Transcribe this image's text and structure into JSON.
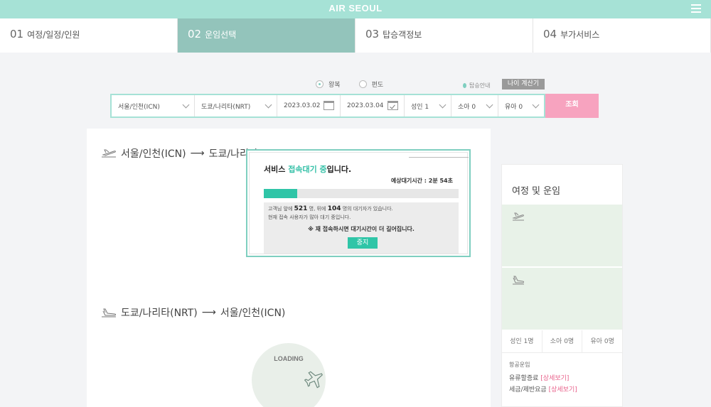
{
  "header": {
    "logo": "AIR SEOUL",
    "menu_icon": "hamburger-icon"
  },
  "steps": [
    {
      "num": "01",
      "label": "여정/일정/인원",
      "active": false
    },
    {
      "num": "02",
      "label": "운임선택",
      "active": true
    },
    {
      "num": "03",
      "label": "탑승객정보",
      "active": false
    },
    {
      "num": "04",
      "label": "부가서비스",
      "active": false
    }
  ],
  "trip_type": {
    "round_trip": "왕복",
    "one_way": "편도",
    "selected": "round_trip"
  },
  "notice": "탑승안내",
  "age_calc_button": "나이 계산기",
  "search": {
    "origin": "서울/인천(ICN)",
    "destination": "도쿄/나리타(NRT)",
    "depart_date": "2023.03.02",
    "return_date": "2023.03.04",
    "adult": "성인 1",
    "child": "소아 0",
    "infant": "유아 0",
    "submit": "조회"
  },
  "routes": {
    "outbound": {
      "from": "서울/인천(ICN)",
      "arrow": "⟶",
      "to": "도쿄/나리타(NRT)"
    },
    "inbound": {
      "from": "도쿄/나리타(NRT)",
      "arrow": "⟶",
      "to": "서울/인천(ICN)"
    }
  },
  "loading": {
    "text": "LOADING"
  },
  "summary": {
    "title": "여정 및 운임",
    "pax": [
      "성인 1명",
      "소아 0명",
      "유아 0명"
    ],
    "fare_label": "항공운임",
    "fuel": "유류할증료",
    "tax": "세금/제반요금",
    "detail_link": "[상세보기]"
  },
  "queue_modal": {
    "title_prefix": "서비스 ",
    "title_highlight": "접속대기 중",
    "title_suffix": "입니다.",
    "wait_label": "예상대기시간 : ",
    "wait_time": "2분 54초",
    "progress": 0.17,
    "line1_prefix": "고객님 앞에 ",
    "ahead_count": "521",
    "line1_middle": " 명, 뒤에 ",
    "behind_count": "104",
    "line1_suffix": " 명의 대기자가 있습니다.",
    "line2": "현재 접속 사용자가 많아 대기 중입니다.",
    "warning": "※ 재 접속하시면 대기시간이 더 길어집니다.",
    "stop_button": "중지"
  }
}
